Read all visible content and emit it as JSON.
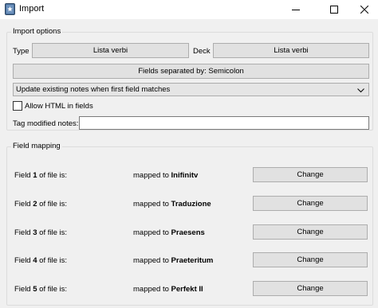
{
  "window": {
    "title": "Import",
    "icon": "anki-app-icon",
    "controls": [
      "minimize-icon",
      "maximize-icon",
      "close-icon"
    ]
  },
  "import_options": {
    "group_title": "Import options",
    "type_label": "Type",
    "type_value": "Lista verbi",
    "deck_label": "Deck",
    "deck_value": "Lista verbi",
    "separator_button": "Fields separated by: Semicolon",
    "update_mode": "Update existing notes when first field matches",
    "allow_html_label": "Allow HTML in fields",
    "allow_html_checked": false,
    "tag_modified_label": "Tag modified notes:",
    "tag_modified_value": ""
  },
  "field_mapping": {
    "group_title": "Field mapping",
    "rows": [
      {
        "pre": "Field ",
        "num": "1",
        "post": " of file is:",
        "mapped_pre": "mapped to ",
        "target": "Inifinitv",
        "button": "Change"
      },
      {
        "pre": "Field ",
        "num": "2",
        "post": " of file is:",
        "mapped_pre": "mapped to ",
        "target": "Traduzione",
        "button": "Change"
      },
      {
        "pre": "Field ",
        "num": "3",
        "post": " of file is:",
        "mapped_pre": "mapped to ",
        "target": "Praesens",
        "button": "Change"
      },
      {
        "pre": "Field ",
        "num": "4",
        "post": " of file is:",
        "mapped_pre": "mapped to ",
        "target": "Praeteritum",
        "button": "Change"
      },
      {
        "pre": "Field ",
        "num": "5",
        "post": " of file is:",
        "mapped_pre": "mapped to ",
        "target": "Perfekt II",
        "button": "Change"
      }
    ]
  }
}
